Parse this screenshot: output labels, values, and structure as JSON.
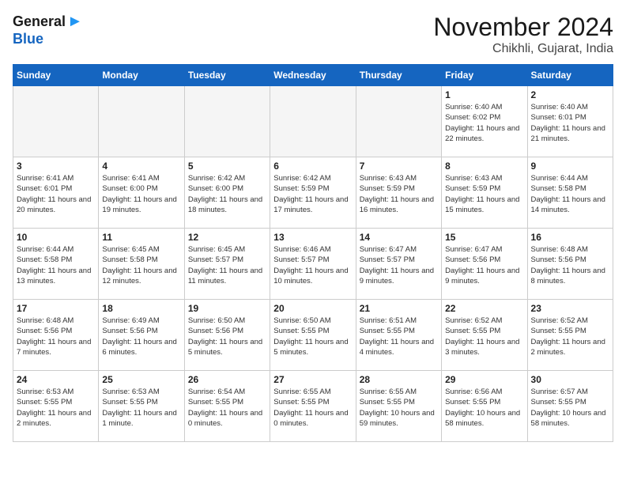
{
  "header": {
    "logo_line1": "General",
    "logo_line2": "Blue",
    "month": "November 2024",
    "location": "Chikhli, Gujarat, India"
  },
  "days_of_week": [
    "Sunday",
    "Monday",
    "Tuesday",
    "Wednesday",
    "Thursday",
    "Friday",
    "Saturday"
  ],
  "weeks": [
    [
      {
        "day": "",
        "empty": true
      },
      {
        "day": "",
        "empty": true
      },
      {
        "day": "",
        "empty": true
      },
      {
        "day": "",
        "empty": true
      },
      {
        "day": "",
        "empty": true
      },
      {
        "day": "1",
        "sunrise": "Sunrise: 6:40 AM",
        "sunset": "Sunset: 6:02 PM",
        "daylight": "Daylight: 11 hours and 22 minutes."
      },
      {
        "day": "2",
        "sunrise": "Sunrise: 6:40 AM",
        "sunset": "Sunset: 6:01 PM",
        "daylight": "Daylight: 11 hours and 21 minutes."
      }
    ],
    [
      {
        "day": "3",
        "sunrise": "Sunrise: 6:41 AM",
        "sunset": "Sunset: 6:01 PM",
        "daylight": "Daylight: 11 hours and 20 minutes."
      },
      {
        "day": "4",
        "sunrise": "Sunrise: 6:41 AM",
        "sunset": "Sunset: 6:00 PM",
        "daylight": "Daylight: 11 hours and 19 minutes."
      },
      {
        "day": "5",
        "sunrise": "Sunrise: 6:42 AM",
        "sunset": "Sunset: 6:00 PM",
        "daylight": "Daylight: 11 hours and 18 minutes."
      },
      {
        "day": "6",
        "sunrise": "Sunrise: 6:42 AM",
        "sunset": "Sunset: 5:59 PM",
        "daylight": "Daylight: 11 hours and 17 minutes."
      },
      {
        "day": "7",
        "sunrise": "Sunrise: 6:43 AM",
        "sunset": "Sunset: 5:59 PM",
        "daylight": "Daylight: 11 hours and 16 minutes."
      },
      {
        "day": "8",
        "sunrise": "Sunrise: 6:43 AM",
        "sunset": "Sunset: 5:59 PM",
        "daylight": "Daylight: 11 hours and 15 minutes."
      },
      {
        "day": "9",
        "sunrise": "Sunrise: 6:44 AM",
        "sunset": "Sunset: 5:58 PM",
        "daylight": "Daylight: 11 hours and 14 minutes."
      }
    ],
    [
      {
        "day": "10",
        "sunrise": "Sunrise: 6:44 AM",
        "sunset": "Sunset: 5:58 PM",
        "daylight": "Daylight: 11 hours and 13 minutes."
      },
      {
        "day": "11",
        "sunrise": "Sunrise: 6:45 AM",
        "sunset": "Sunset: 5:58 PM",
        "daylight": "Daylight: 11 hours and 12 minutes."
      },
      {
        "day": "12",
        "sunrise": "Sunrise: 6:45 AM",
        "sunset": "Sunset: 5:57 PM",
        "daylight": "Daylight: 11 hours and 11 minutes."
      },
      {
        "day": "13",
        "sunrise": "Sunrise: 6:46 AM",
        "sunset": "Sunset: 5:57 PM",
        "daylight": "Daylight: 11 hours and 10 minutes."
      },
      {
        "day": "14",
        "sunrise": "Sunrise: 6:47 AM",
        "sunset": "Sunset: 5:57 PM",
        "daylight": "Daylight: 11 hours and 9 minutes."
      },
      {
        "day": "15",
        "sunrise": "Sunrise: 6:47 AM",
        "sunset": "Sunset: 5:56 PM",
        "daylight": "Daylight: 11 hours and 9 minutes."
      },
      {
        "day": "16",
        "sunrise": "Sunrise: 6:48 AM",
        "sunset": "Sunset: 5:56 PM",
        "daylight": "Daylight: 11 hours and 8 minutes."
      }
    ],
    [
      {
        "day": "17",
        "sunrise": "Sunrise: 6:48 AM",
        "sunset": "Sunset: 5:56 PM",
        "daylight": "Daylight: 11 hours and 7 minutes."
      },
      {
        "day": "18",
        "sunrise": "Sunrise: 6:49 AM",
        "sunset": "Sunset: 5:56 PM",
        "daylight": "Daylight: 11 hours and 6 minutes."
      },
      {
        "day": "19",
        "sunrise": "Sunrise: 6:50 AM",
        "sunset": "Sunset: 5:56 PM",
        "daylight": "Daylight: 11 hours and 5 minutes."
      },
      {
        "day": "20",
        "sunrise": "Sunrise: 6:50 AM",
        "sunset": "Sunset: 5:55 PM",
        "daylight": "Daylight: 11 hours and 5 minutes."
      },
      {
        "day": "21",
        "sunrise": "Sunrise: 6:51 AM",
        "sunset": "Sunset: 5:55 PM",
        "daylight": "Daylight: 11 hours and 4 minutes."
      },
      {
        "day": "22",
        "sunrise": "Sunrise: 6:52 AM",
        "sunset": "Sunset: 5:55 PM",
        "daylight": "Daylight: 11 hours and 3 minutes."
      },
      {
        "day": "23",
        "sunrise": "Sunrise: 6:52 AM",
        "sunset": "Sunset: 5:55 PM",
        "daylight": "Daylight: 11 hours and 2 minutes."
      }
    ],
    [
      {
        "day": "24",
        "sunrise": "Sunrise: 6:53 AM",
        "sunset": "Sunset: 5:55 PM",
        "daylight": "Daylight: 11 hours and 2 minutes."
      },
      {
        "day": "25",
        "sunrise": "Sunrise: 6:53 AM",
        "sunset": "Sunset: 5:55 PM",
        "daylight": "Daylight: 11 hours and 1 minute."
      },
      {
        "day": "26",
        "sunrise": "Sunrise: 6:54 AM",
        "sunset": "Sunset: 5:55 PM",
        "daylight": "Daylight: 11 hours and 0 minutes."
      },
      {
        "day": "27",
        "sunrise": "Sunrise: 6:55 AM",
        "sunset": "Sunset: 5:55 PM",
        "daylight": "Daylight: 11 hours and 0 minutes."
      },
      {
        "day": "28",
        "sunrise": "Sunrise: 6:55 AM",
        "sunset": "Sunset: 5:55 PM",
        "daylight": "Daylight: 10 hours and 59 minutes."
      },
      {
        "day": "29",
        "sunrise": "Sunrise: 6:56 AM",
        "sunset": "Sunset: 5:55 PM",
        "daylight": "Daylight: 10 hours and 58 minutes."
      },
      {
        "day": "30",
        "sunrise": "Sunrise: 6:57 AM",
        "sunset": "Sunset: 5:55 PM",
        "daylight": "Daylight: 10 hours and 58 minutes."
      }
    ]
  ]
}
